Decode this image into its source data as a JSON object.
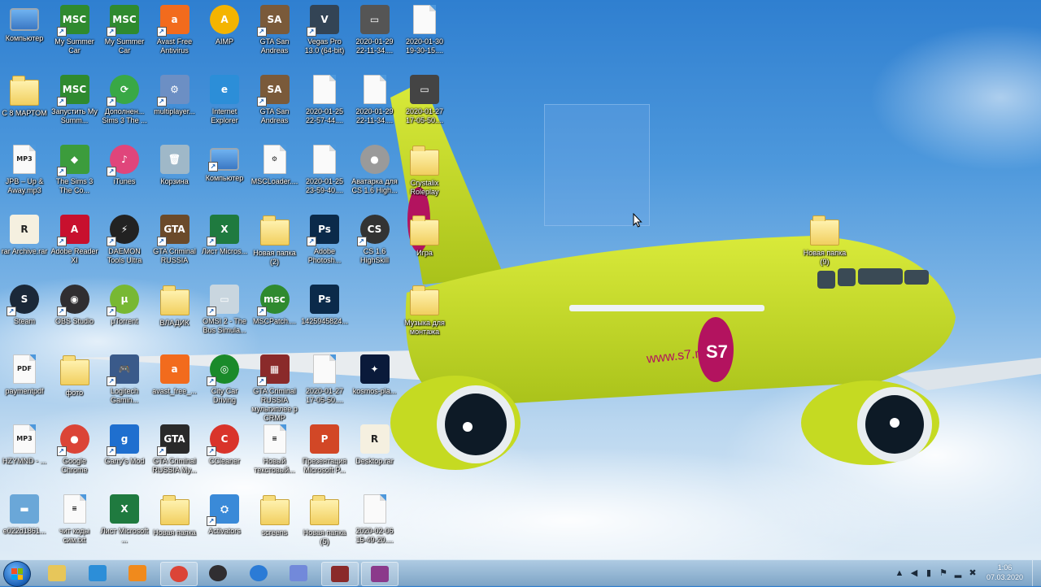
{
  "desktop": {
    "icons": [
      {
        "label": "Компьютер",
        "kind": "monitor",
        "color": "#3b78c4",
        "text": "",
        "shortcut": false,
        "col": 0,
        "row": 0
      },
      {
        "label": "My Summer Car",
        "kind": "app",
        "color": "#2f8a2f",
        "text": "MSC",
        "shortcut": true,
        "col": 1,
        "row": 0
      },
      {
        "label": "My Summer Car",
        "kind": "app",
        "color": "#2f8a2f",
        "text": "MSC",
        "shortcut": true,
        "col": 2,
        "row": 0
      },
      {
        "label": "Avast Free Antivirus",
        "kind": "app",
        "color": "#f26b1d",
        "text": "a",
        "shortcut": true,
        "col": 3,
        "row": 0
      },
      {
        "label": "AIMP",
        "kind": "round",
        "color": "#f4b400",
        "text": "A",
        "shortcut": false,
        "col": 4,
        "row": 0
      },
      {
        "label": "GTA San Andreas",
        "kind": "app",
        "color": "#7a5a3a",
        "text": "SA",
        "shortcut": true,
        "col": 5,
        "row": 0
      },
      {
        "label": "Vegas Pro 13.0 (64-bit)",
        "kind": "app",
        "color": "#334455",
        "text": "V",
        "shortcut": true,
        "col": 6,
        "row": 0
      },
      {
        "label": "2020-01-29 22-11-34....",
        "kind": "app",
        "color": "#555555",
        "text": "▭",
        "shortcut": false,
        "col": 7,
        "row": 0
      },
      {
        "label": "2020-01-30 19-30-15....",
        "kind": "file",
        "color": "",
        "text": "",
        "shortcut": false,
        "col": 8,
        "row": 0
      },
      {
        "label": "С 8 МАРТОМ",
        "kind": "folder",
        "color": "",
        "text": "",
        "shortcut": false,
        "col": 0,
        "row": 1
      },
      {
        "label": "Запустить My Summ...",
        "kind": "app",
        "color": "#2f8a2f",
        "text": "MSC",
        "shortcut": true,
        "col": 1,
        "row": 1
      },
      {
        "label": "Дополнен... Sims 3 The ...",
        "kind": "round",
        "color": "#39a845",
        "text": "⟳",
        "shortcut": true,
        "col": 2,
        "row": 1
      },
      {
        "label": "multiplayer...",
        "kind": "app",
        "color": "#6c8fc4",
        "text": "⚙",
        "shortcut": true,
        "col": 3,
        "row": 1
      },
      {
        "label": "Internet Explorer",
        "kind": "app",
        "color": "#2c8ed8",
        "text": "e",
        "shortcut": false,
        "col": 4,
        "row": 1
      },
      {
        "label": "GTA San Andreas",
        "kind": "app",
        "color": "#7a5a3a",
        "text": "SA",
        "shortcut": true,
        "col": 5,
        "row": 1
      },
      {
        "label": "2020-01-25 22-57-44....",
        "kind": "file",
        "color": "",
        "text": "",
        "shortcut": false,
        "col": 6,
        "row": 1
      },
      {
        "label": "2020-01-29 22-11-34....",
        "kind": "file",
        "color": "",
        "text": "",
        "shortcut": false,
        "col": 7,
        "row": 1
      },
      {
        "label": "2020-01-27 17-05-50....",
        "kind": "app",
        "color": "#444444",
        "text": "▭",
        "shortcut": false,
        "col": 8,
        "row": 1
      },
      {
        "label": "JPB – Up & Away.mp3",
        "kind": "file",
        "color": "",
        "text": "MP3",
        "shortcut": false,
        "col": 0,
        "row": 2
      },
      {
        "label": "The Sims 3 The Co...",
        "kind": "app",
        "color": "#3c9c3c",
        "text": "◆",
        "shortcut": true,
        "col": 1,
        "row": 2
      },
      {
        "label": "iTunes",
        "kind": "round",
        "color": "#e0457b",
        "text": "♪",
        "shortcut": true,
        "col": 2,
        "row": 2
      },
      {
        "label": "Корзина",
        "kind": "app",
        "color": "#9fb8c8",
        "text": "🗑",
        "shortcut": false,
        "col": 3,
        "row": 2
      },
      {
        "label": "Компьютер",
        "kind": "monitor",
        "color": "#3b78c4",
        "text": "",
        "shortcut": true,
        "col": 4,
        "row": 2
      },
      {
        "label": "MSCLoader....",
        "kind": "file",
        "color": "",
        "text": "⚙",
        "shortcut": false,
        "col": 5,
        "row": 2
      },
      {
        "label": "2020-01-25 23-59-40....",
        "kind": "file",
        "color": "",
        "text": "",
        "shortcut": false,
        "col": 6,
        "row": 2
      },
      {
        "label": "Аватарка для CS 1.6 High...",
        "kind": "round",
        "color": "#9a9a9a",
        "text": "●",
        "shortcut": false,
        "col": 7,
        "row": 2
      },
      {
        "label": "Crystalix Roleplay",
        "kind": "folder",
        "color": "",
        "text": "",
        "shortcut": false,
        "col": 8,
        "row": 2
      },
      {
        "label": "rar Archive.rar",
        "kind": "app",
        "color": "#f5f0e0",
        "text": "R",
        "shortcut": false,
        "col": 0,
        "row": 3
      },
      {
        "label": "Adobe Reader XI",
        "kind": "app",
        "color": "#c8102e",
        "text": "A",
        "shortcut": true,
        "col": 1,
        "row": 3
      },
      {
        "label": "DAEMON Tools Ultra",
        "kind": "round",
        "color": "#222222",
        "text": "⚡",
        "shortcut": true,
        "col": 2,
        "row": 3
      },
      {
        "label": "GTA Criminal RUSSIA",
        "kind": "app",
        "color": "#6b4a2a",
        "text": "GTA",
        "shortcut": true,
        "col": 3,
        "row": 3
      },
      {
        "label": "Лист Micros...",
        "kind": "app",
        "color": "#1f7a3f",
        "text": "X",
        "shortcut": true,
        "col": 4,
        "row": 3
      },
      {
        "label": "Новая папка (2)",
        "kind": "folder",
        "color": "",
        "text": "",
        "shortcut": false,
        "col": 5,
        "row": 3
      },
      {
        "label": "Adobe Photosh...",
        "kind": "app",
        "color": "#0b2a4a",
        "text": "Ps",
        "shortcut": true,
        "col": 6,
        "row": 3
      },
      {
        "label": "CS 1.6 HighSkill",
        "kind": "round",
        "color": "#333333",
        "text": "CS",
        "shortcut": true,
        "col": 7,
        "row": 3
      },
      {
        "label": "Игра",
        "kind": "folder",
        "color": "",
        "text": "",
        "shortcut": false,
        "col": 8,
        "row": 3
      },
      {
        "label": "Steam",
        "kind": "round",
        "color": "#1b2838",
        "text": "S",
        "shortcut": true,
        "col": 0,
        "row": 4
      },
      {
        "label": "OBS Studio",
        "kind": "round",
        "color": "#302e31",
        "text": "◉",
        "shortcut": true,
        "col": 1,
        "row": 4
      },
      {
        "label": "µTorrent",
        "kind": "round",
        "color": "#78b833",
        "text": "µ",
        "shortcut": true,
        "col": 2,
        "row": 4
      },
      {
        "label": "ВЛАДИК",
        "kind": "folder",
        "color": "",
        "text": "",
        "shortcut": false,
        "col": 3,
        "row": 4
      },
      {
        "label": "OMSI 2 - The Bus Simula...",
        "kind": "app",
        "color": "#c9d6df",
        "text": "▭",
        "shortcut": true,
        "col": 4,
        "row": 4
      },
      {
        "label": "MSCPatch....",
        "kind": "round",
        "color": "#2f8a2f",
        "text": "msc",
        "shortcut": true,
        "col": 5,
        "row": 4
      },
      {
        "label": "1425945824...",
        "kind": "app",
        "color": "#0b2a4a",
        "text": "Ps",
        "shortcut": false,
        "col": 6,
        "row": 4
      },
      {
        "label": "Музыка для монтажа",
        "kind": "folder",
        "color": "",
        "text": "",
        "shortcut": false,
        "col": 8,
        "row": 4
      },
      {
        "label": "paymentpdf",
        "kind": "file",
        "color": "",
        "text": "PDF",
        "shortcut": false,
        "col": 0,
        "row": 5
      },
      {
        "label": "фото",
        "kind": "folder",
        "color": "",
        "text": "",
        "shortcut": false,
        "col": 1,
        "row": 5
      },
      {
        "label": "Logitech Gamin...",
        "kind": "app",
        "color": "#3a5a8a",
        "text": "🎮",
        "shortcut": true,
        "col": 2,
        "row": 5
      },
      {
        "label": "avast_free_...",
        "kind": "app",
        "color": "#f26b1d",
        "text": "a",
        "shortcut": false,
        "col": 3,
        "row": 5
      },
      {
        "label": "City Car Driving",
        "kind": "round",
        "color": "#1a8a2a",
        "text": "◎",
        "shortcut": true,
        "col": 4,
        "row": 5
      },
      {
        "label": "GTA Criminal RUSSIA мультиплее р CRMP",
        "kind": "app",
        "color": "#8a2a2a",
        "text": "▦",
        "shortcut": true,
        "col": 5,
        "row": 5
      },
      {
        "label": "2020-01-27 17-05-50....",
        "kind": "file",
        "color": "",
        "text": "",
        "shortcut": false,
        "col": 6,
        "row": 5
      },
      {
        "label": "kosmos-pla...",
        "kind": "app",
        "color": "#0a1a3a",
        "text": "✦",
        "shortcut": false,
        "col": 7,
        "row": 5
      },
      {
        "label": "HZYMND - ...",
        "kind": "file",
        "color": "",
        "text": "MP3",
        "shortcut": false,
        "col": 0,
        "row": 6
      },
      {
        "label": "Google Chrome",
        "kind": "round",
        "color": "#db4437",
        "text": "●",
        "shortcut": true,
        "col": 1,
        "row": 6
      },
      {
        "label": "Garry's Mod",
        "kind": "app",
        "color": "#1f6fcf",
        "text": "g",
        "shortcut": true,
        "col": 2,
        "row": 6
      },
      {
        "label": "GTA Criminal RUSSIA My...",
        "kind": "app",
        "color": "#2a2a2a",
        "text": "GTA",
        "shortcut": true,
        "col": 3,
        "row": 6
      },
      {
        "label": "CCleaner",
        "kind": "round",
        "color": "#d9342b",
        "text": "C",
        "shortcut": true,
        "col": 4,
        "row": 6
      },
      {
        "label": "Новый текстовый...",
        "kind": "file",
        "color": "",
        "text": "≡",
        "shortcut": false,
        "col": 5,
        "row": 6
      },
      {
        "label": "Презентация Microsoft P...",
        "kind": "app",
        "color": "#d24726",
        "text": "P",
        "shortcut": false,
        "col": 6,
        "row": 6
      },
      {
        "label": "Desktop.rar",
        "kind": "app",
        "color": "#f5f0e0",
        "text": "R",
        "shortcut": false,
        "col": 7,
        "row": 6
      },
      {
        "label": "e022d1861...",
        "kind": "app",
        "color": "#6aa7d8",
        "text": "▬",
        "shortcut": false,
        "col": 0,
        "row": 7
      },
      {
        "label": "чит коды сим.txt",
        "kind": "file",
        "color": "",
        "text": "≡",
        "shortcut": false,
        "col": 1,
        "row": 7
      },
      {
        "label": "Лист Microsoft ...",
        "kind": "app",
        "color": "#1f7a3f",
        "text": "X",
        "shortcut": false,
        "col": 2,
        "row": 7
      },
      {
        "label": "Новая папка",
        "kind": "folder",
        "color": "",
        "text": "",
        "shortcut": false,
        "col": 3,
        "row": 7
      },
      {
        "label": "Activators",
        "kind": "app",
        "color": "#3a8ad8",
        "text": "⛭",
        "shortcut": true,
        "col": 4,
        "row": 7
      },
      {
        "label": "screens",
        "kind": "folder",
        "color": "",
        "text": "",
        "shortcut": false,
        "col": 5,
        "row": 7
      },
      {
        "label": "Новая папка (5)",
        "kind": "folder",
        "color": "",
        "text": "",
        "shortcut": false,
        "col": 6,
        "row": 7
      },
      {
        "label": "2020-02-06 15-49-20....",
        "kind": "file",
        "color": "",
        "text": "",
        "shortcut": false,
        "col": 7,
        "row": 7
      },
      {
        "label": "Новая папка (9)",
        "kind": "folder",
        "color": "",
        "text": "",
        "shortcut": false,
        "col": 16,
        "row": 3
      }
    ]
  },
  "wallpaper": {
    "livery_text": "www.s7.ru",
    "logo_text": "S7",
    "body_color": "#c8dc1e",
    "logo_color": "#b3135f"
  },
  "taskbar": {
    "pinned": [
      {
        "name": "explorer",
        "icon": "folder-icon",
        "color": "#e7c65a",
        "active": false
      },
      {
        "name": "internet-explorer",
        "icon": "ie-icon",
        "color": "#2c8ed8",
        "active": false
      },
      {
        "name": "media-player",
        "icon": "media-player-icon",
        "color": "#f08a1c",
        "active": false
      },
      {
        "name": "chrome",
        "icon": "chrome-icon",
        "color": "#db4437",
        "active": true
      },
      {
        "name": "obs",
        "icon": "obs-icon",
        "color": "#302e31",
        "active": false
      },
      {
        "name": "app-blue",
        "icon": "dots-icon",
        "color": "#2b7bd6",
        "active": false
      },
      {
        "name": "discord",
        "icon": "discord-icon",
        "color": "#7289da",
        "active": false
      },
      {
        "name": "gta-crmp",
        "icon": "gta-icon",
        "color": "#8a2a2a",
        "active": true
      },
      {
        "name": "winrar",
        "icon": "winrar-icon",
        "color": "#8b3a8b",
        "active": true
      }
    ],
    "clock": {
      "time": "1:06",
      "date": "07.03.2020"
    },
    "tray_icons": [
      "expand-tray-icon",
      "volume-icon",
      "network-icon",
      "flag-icon"
    ]
  }
}
